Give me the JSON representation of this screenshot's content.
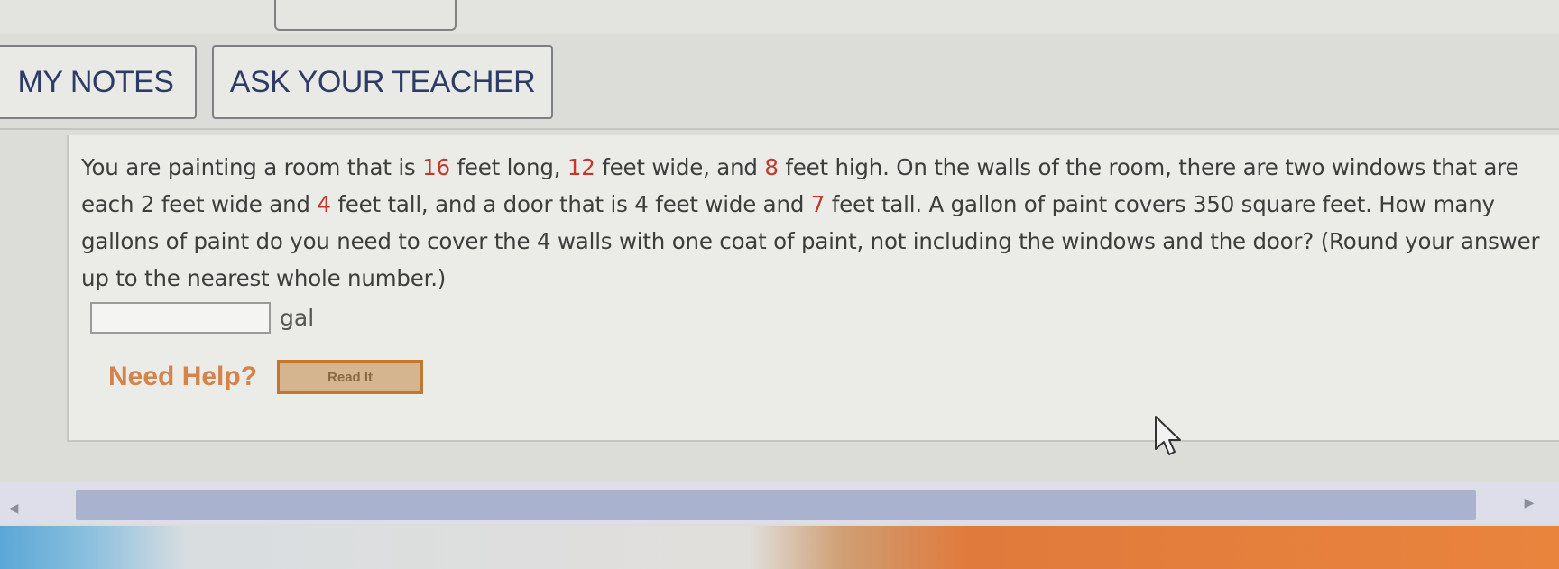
{
  "toolbar": {
    "my_notes_label": "MY NOTES",
    "ask_teacher_label": "ASK YOUR TEACHER"
  },
  "question": {
    "parts": [
      "You are painting a room that is ",
      "16",
      " feet long, ",
      "12",
      " feet wide, and ",
      "8",
      " feet high. On the walls of the room, there are two windows that are each 2 feet wide and ",
      "4",
      " feet tall, and a door that is 4 feet wide and ",
      "7",
      " feet tall. A gallon of paint covers 350 square feet. How many gallons of paint do you need to cover the 4 walls with one coat of paint, not including the windows and the door? (Round your answer up to the nearest whole number.)"
    ]
  },
  "answer": {
    "value": "",
    "unit": "gal"
  },
  "help": {
    "label": "Need Help?",
    "read_button": "Read It"
  },
  "scrollbar": {
    "left_arrow": "◀",
    "right_arrow": "▶"
  },
  "colors": {
    "highlight_number": "#c0392b",
    "button_text": "#2c3c66",
    "need_help": "#d4844a"
  },
  "icons": {
    "cursor": "mouse-pointer-icon"
  }
}
